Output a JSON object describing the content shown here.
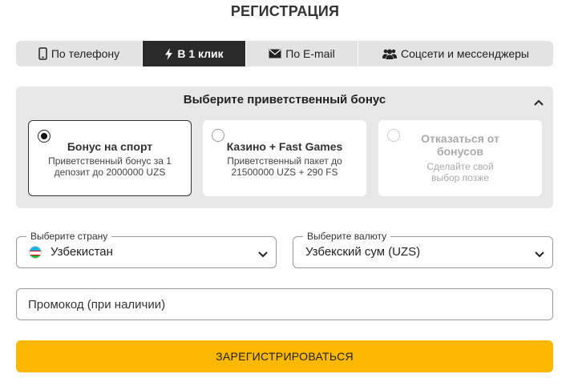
{
  "page": {
    "title": "РЕГИСТРАЦИЯ"
  },
  "tabs": [
    {
      "label": "По телефону",
      "icon": "phone-icon",
      "active": false
    },
    {
      "label": "В 1 клик",
      "icon": "lightning-icon",
      "active": true
    },
    {
      "label": "По E-mail",
      "icon": "envelope-icon",
      "active": false
    },
    {
      "label": "Соцсети и мессенджеры",
      "icon": "users-icon",
      "active": false
    }
  ],
  "bonus": {
    "title": "Выберите приветственный бонус",
    "cards": [
      {
        "title": "Бонус на спорт",
        "desc": "Приветственный бонус за 1 депозит до 2000000 UZS",
        "selected": true
      },
      {
        "title": "Казино + Fast Games",
        "desc": "Приветственный пакет до 21500000 UZS + 290 FS",
        "selected": false
      },
      {
        "title": "Отказаться от бонусов",
        "desc": "Сделайте свой выбор позже",
        "selected": false
      }
    ]
  },
  "country": {
    "label": "Выберите страну",
    "value": "Узбекистан",
    "flag": "uzbekistan-flag"
  },
  "currency": {
    "label": "Выберите валюту",
    "value": "Узбекский сум (UZS)"
  },
  "promo": {
    "placeholder": "Промокод (при наличии)"
  },
  "submit": {
    "label": "ЗАРЕГИСТРИРОВАТЬСЯ"
  },
  "colors": {
    "accent": "#fbb800",
    "active_tab": "#2a2a2a",
    "panel": "#e8e8e8"
  }
}
